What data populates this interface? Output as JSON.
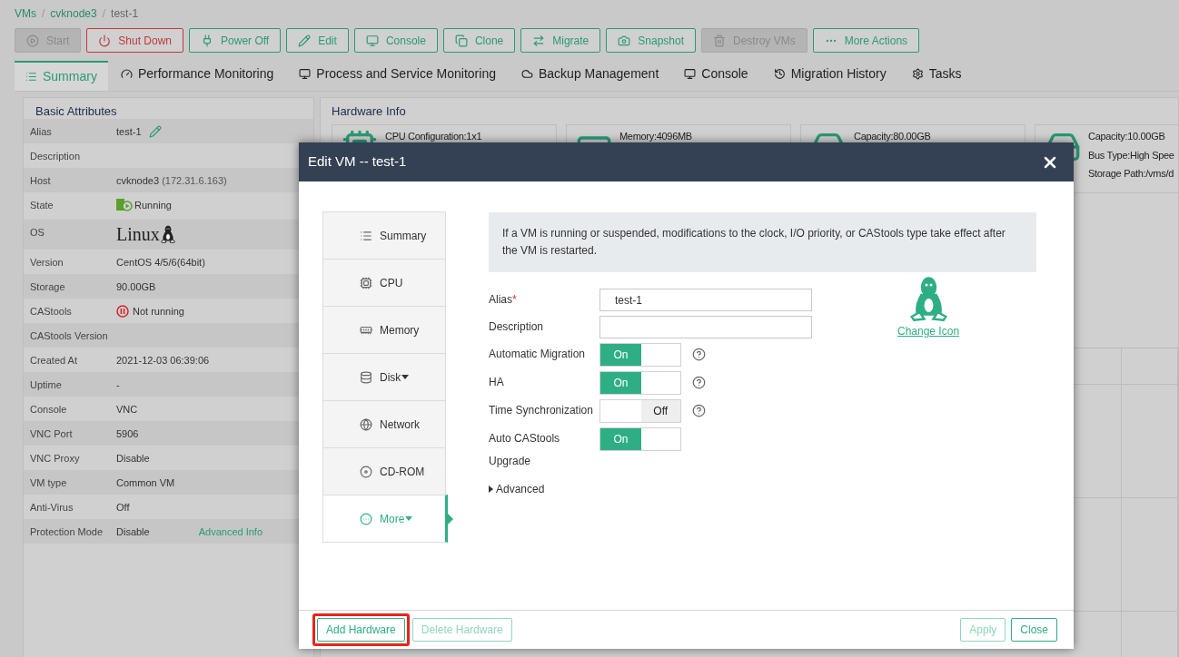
{
  "breadcrumb": [
    {
      "kind": "link",
      "text": "VMs"
    },
    {
      "kind": "separator",
      "text": "/"
    },
    {
      "kind": "link",
      "text": "cvknode3"
    },
    {
      "kind": "separator",
      "text": "/"
    },
    {
      "kind": "current",
      "text": "test-1"
    }
  ],
  "toolbar": [
    {
      "label": "Start",
      "kind": "normal",
      "disabled": true
    },
    {
      "label": "Shut Down",
      "kind": "danger",
      "disabled": false
    },
    {
      "label": "Power Off",
      "kind": "normal",
      "disabled": false
    },
    {
      "label": "Edit",
      "kind": "normal",
      "disabled": false
    },
    {
      "label": "Console",
      "kind": "normal",
      "disabled": false
    },
    {
      "label": "Clone",
      "kind": "normal",
      "disabled": false
    },
    {
      "label": "Migrate",
      "kind": "normal",
      "disabled": false
    },
    {
      "label": "Snapshot",
      "kind": "normal",
      "disabled": false
    },
    {
      "label": "Destroy VMs",
      "kind": "normal",
      "disabled": true
    },
    {
      "label": "More Actions",
      "kind": "normal",
      "disabled": false
    }
  ],
  "tabs": [
    {
      "label": "Summary",
      "selected": true
    },
    {
      "label": "Performance Monitoring",
      "selected": false
    },
    {
      "label": "Process and Service Monitoring",
      "selected": false
    },
    {
      "label": "Backup Management",
      "selected": false
    },
    {
      "label": "Console",
      "selected": false
    },
    {
      "label": "Migration History",
      "selected": false
    },
    {
      "label": "Tasks",
      "selected": false
    }
  ],
  "basic_attributes": {
    "title": "Basic Attributes",
    "rows": [
      {
        "label": "Alias",
        "value": "test-1",
        "kind": "editable"
      },
      {
        "label": "Description",
        "kind": "plain"
      },
      {
        "label": "Host",
        "value": "cvknode3",
        "extra": "(172.31.6.163)",
        "kind": "plain"
      },
      {
        "label": "State",
        "value": "Running",
        "kind": "running"
      },
      {
        "label": "OS",
        "value": "Linux",
        "kind": "os"
      },
      {
        "label": "Version",
        "value": "CentOS 4/5/6(64bit)",
        "kind": "plain"
      },
      {
        "label": "Storage",
        "value": "90.00GB",
        "kind": "plain"
      },
      {
        "label": "CAStools",
        "value": "Not running",
        "kind": "stopped"
      },
      {
        "label": "CAStools Version",
        "kind": "plain"
      },
      {
        "label": "Created At",
        "value": "2021-12-03 06:39:06",
        "kind": "plain"
      },
      {
        "label": "Uptime",
        "value": "-",
        "kind": "plain"
      },
      {
        "label": "Console",
        "value": "VNC",
        "kind": "plain"
      },
      {
        "label": "VNC Port",
        "value": "5906",
        "kind": "plain"
      },
      {
        "label": "VNC Proxy",
        "value": "Disable",
        "kind": "plain"
      },
      {
        "label": "VM type",
        "value": "Common VM",
        "kind": "plain"
      },
      {
        "label": "Anti-Virus",
        "value": "Off",
        "kind": "plain"
      },
      {
        "label": "Protection Mode",
        "value": "Disable",
        "link": "Advanced Info",
        "kind": "plain"
      }
    ]
  },
  "hardware": {
    "title": "Hardware Info",
    "cards": [
      {
        "lines": [
          "CPU Configuration:1x1"
        ]
      },
      {
        "lines": [
          "Memory:4096MB"
        ]
      },
      {
        "lines": [
          "Capacity:80.00GB"
        ]
      },
      {
        "lines": [
          "Capacity:10.00GB",
          "Bus Type:High Spee",
          "Storage Path:/vms/d"
        ]
      }
    ]
  },
  "modal": {
    "title": "Edit VM -- test-1",
    "nav": [
      {
        "label": "Summary",
        "dropdown": false,
        "selected": false
      },
      {
        "label": "CPU",
        "dropdown": false,
        "selected": false
      },
      {
        "label": "Memory",
        "dropdown": false,
        "selected": false
      },
      {
        "label": "Disk",
        "dropdown": true,
        "selected": false
      },
      {
        "label": "Network",
        "dropdown": false,
        "selected": false
      },
      {
        "label": "CD-ROM",
        "dropdown": false,
        "selected": false
      },
      {
        "label": "More",
        "dropdown": true,
        "selected": true
      }
    ],
    "notice": "If a VM is running or suspended, modifications to the clock, I/O priority, or CAStools type take effect after the VM is restarted.",
    "fields": [
      {
        "kind": "text",
        "label": "Alias",
        "required_mark": "*",
        "value": "test-1"
      },
      {
        "kind": "text",
        "label": "Description"
      },
      {
        "kind": "toggle",
        "label": "Automatic Migration",
        "on": true,
        "state_label": "On",
        "help": true
      },
      {
        "kind": "toggle",
        "label": "HA",
        "on": true,
        "state_label": "On",
        "help": true
      },
      {
        "kind": "toggle",
        "label": "Time Synchronization",
        "on": false,
        "state_label": "Off",
        "help": true
      },
      {
        "kind": "toggle",
        "label": "Auto CAStools Upgrade",
        "on": true,
        "state_label": "On",
        "help": false
      }
    ],
    "advanced": {
      "label": "Advanced",
      "expanded": false
    },
    "change_icon": "Change Icon",
    "footer_left": [
      {
        "label": "Add Hardware",
        "highlighted": true,
        "disabled": false
      },
      {
        "label": "Delete Hardware",
        "highlighted": false,
        "disabled": true
      }
    ],
    "footer_right": [
      {
        "label": "Apply",
        "highlighted": false,
        "disabled": true
      },
      {
        "label": "Close",
        "highlighted": false,
        "disabled": false
      }
    ]
  }
}
